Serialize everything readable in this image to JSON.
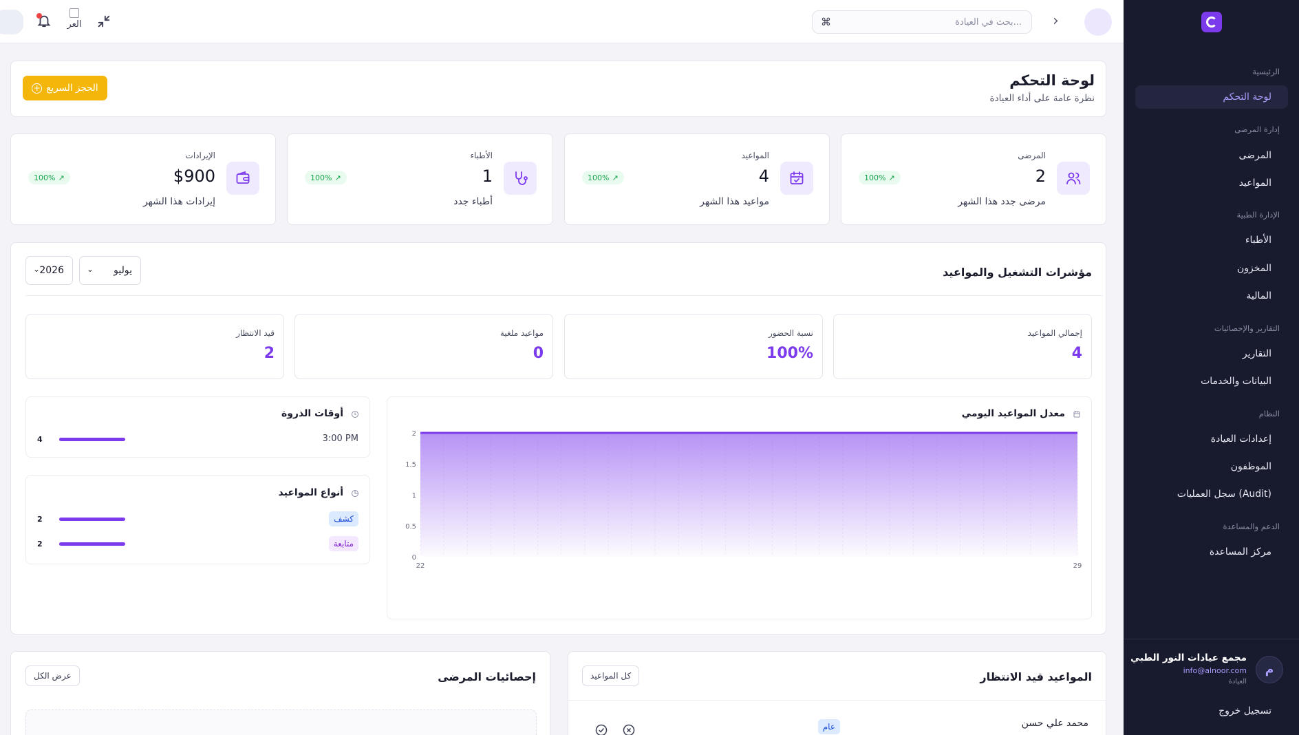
{
  "topbar": {
    "search_placeholder": "بحث في العيادة...",
    "search_shortcut": "⌘",
    "language_label": "العر"
  },
  "sidebar": {
    "sections": [
      {
        "title": "الرئيسية",
        "items": [
          "لوحة التحكم"
        ]
      },
      {
        "title": "إدارة المرضى",
        "items": [
          "المرضى",
          "المواعيد"
        ]
      },
      {
        "title": "الإدارة الطبية",
        "items": [
          "الأطباء",
          "المخزون",
          "المالية"
        ]
      },
      {
        "title": "التقارير والإحصائيات",
        "items": [
          "التقارير",
          "البيانات والخدمات"
        ]
      },
      {
        "title": "النظام",
        "items": [
          "إعدادات العيادة",
          "الموظفون",
          "سجل العمليات (Audit)"
        ]
      },
      {
        "title": "الدعم والمساعدة",
        "items": [
          "مركز المساعدة"
        ]
      }
    ],
    "active_item": "لوحة التحكم",
    "org": {
      "avatar_letter": "م",
      "name": "مجمع عيادات النور الطبي",
      "email": "info@alnoor.com",
      "role": "العيادة"
    },
    "logout": "تسجيل خروج"
  },
  "header": {
    "title": "لوحة التحكم",
    "subtitle": "نظرة عامة على أداء العيادة",
    "quick_booking": "الحجز السريع"
  },
  "stats": [
    {
      "icon": "users-icon",
      "label": "المرضى",
      "value": "2",
      "sub": "مرضى جدد هذا الشهر",
      "badge": "100%"
    },
    {
      "icon": "calendar-check-icon",
      "label": "المواعيد",
      "value": "4",
      "sub": "مواعيد هذا الشهر",
      "badge": "100%"
    },
    {
      "icon": "stethoscope-icon",
      "label": "الأطباء",
      "value": "1",
      "sub": "أطباء جدد",
      "badge": "100%"
    },
    {
      "icon": "wallet-icon",
      "label": "الإيرادات",
      "value": "$900",
      "sub": "إيرادات هذا الشهر",
      "badge": "100%"
    }
  ],
  "operations": {
    "title": "مؤشرات التشغيل والمواعيد",
    "month": "يوليو",
    "year": "2026",
    "kpis": [
      {
        "label": "إجمالي المواعيد",
        "value": "4"
      },
      {
        "label": "نسبة الحضور",
        "value": "100%"
      },
      {
        "label": "مواعيد ملغية",
        "value": "0"
      },
      {
        "label": "قيد الانتظار",
        "value": "2"
      }
    ],
    "peak_hours": {
      "title": "أوقات الذروة",
      "rows": [
        {
          "label": "3:00 PM",
          "count": "4"
        }
      ]
    },
    "appointment_types": {
      "title": "أنواع المواعيد",
      "rows": [
        {
          "label": "كشف",
          "count": "2",
          "color": "#dbeafe",
          "text_color": "#1d4ed8"
        },
        {
          "label": "متابعة",
          "count": "2",
          "color": "#f3e8ff",
          "text_color": "#7e22ce"
        }
      ]
    }
  },
  "chart_data": {
    "type": "area",
    "title": "معدل المواعيد اليومي",
    "x": [
      "22",
      "29"
    ],
    "series": [
      {
        "values": [
          2,
          2
        ]
      }
    ],
    "ylim": [
      0,
      2
    ],
    "yticks": [
      "0",
      "0.5",
      "1",
      "1.5",
      "2"
    ],
    "xticks": [
      "22",
      "29"
    ],
    "color": "#7c3aed"
  },
  "pending": {
    "title": "المواعيد قيد الانتظار",
    "all_button": "كل المواعيد",
    "first_patient": "محمد علي حسن",
    "first_tag": "عام"
  },
  "patient_stats": {
    "title": "إحصائيات المرضى",
    "view_all": "عرض الكل"
  }
}
